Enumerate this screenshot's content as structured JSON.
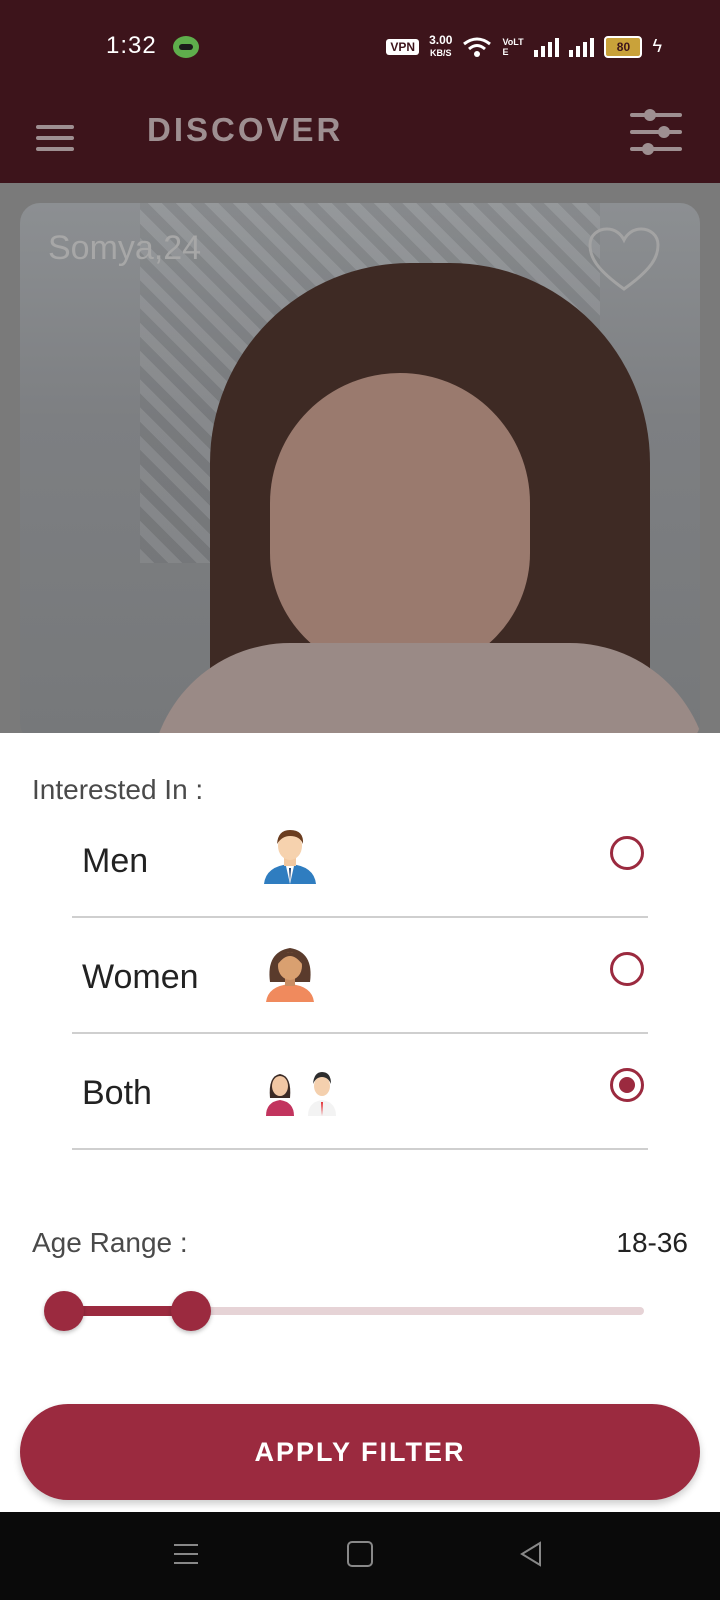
{
  "status_bar": {
    "time": "1:32",
    "vpn": "VPN",
    "speed_value": "3.00",
    "speed_unit": "KB/S",
    "vo_lte": "VoLTE",
    "battery": "80"
  },
  "app_bar": {
    "title": "DISCOVER"
  },
  "profile_card": {
    "name_age": "Somya,24"
  },
  "filter": {
    "interested_label": "Interested In :",
    "options": [
      {
        "label": "Men",
        "emoji": "👨‍💼",
        "selected": false
      },
      {
        "label": "Women",
        "emoji": "👩",
        "selected": false
      },
      {
        "label": "Both",
        "emoji": "👩‍💼👨‍💼",
        "selected": true
      }
    ],
    "age_label": "Age Range :",
    "age_value": "18-36",
    "age_min": 18,
    "age_max": 36,
    "apply_label": "APPLY FILTER"
  },
  "colors": {
    "header": "#3d141b",
    "accent": "#9b2a3f"
  }
}
